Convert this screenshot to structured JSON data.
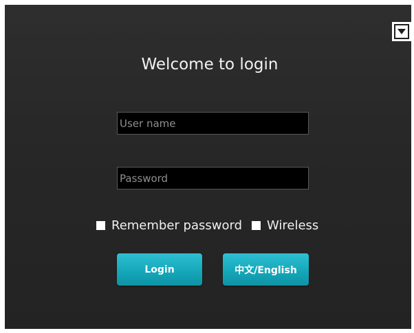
{
  "login": {
    "title": "Welcome to login",
    "username_placeholder": "User name",
    "username_value": "",
    "password_placeholder": "Password",
    "password_value": "",
    "remember_label": "Remember password",
    "remember_checked": false,
    "wireless_label": "Wireless",
    "wireless_checked": false,
    "login_label": "Login",
    "language_label": "中文/English"
  },
  "header": {
    "menu_icon": "dropdown-arrow-icon"
  },
  "colors": {
    "background": "#2a2a2a",
    "field_background": "#000000",
    "button_accent": "#17a9bb",
    "text": "#f2f2f2"
  }
}
